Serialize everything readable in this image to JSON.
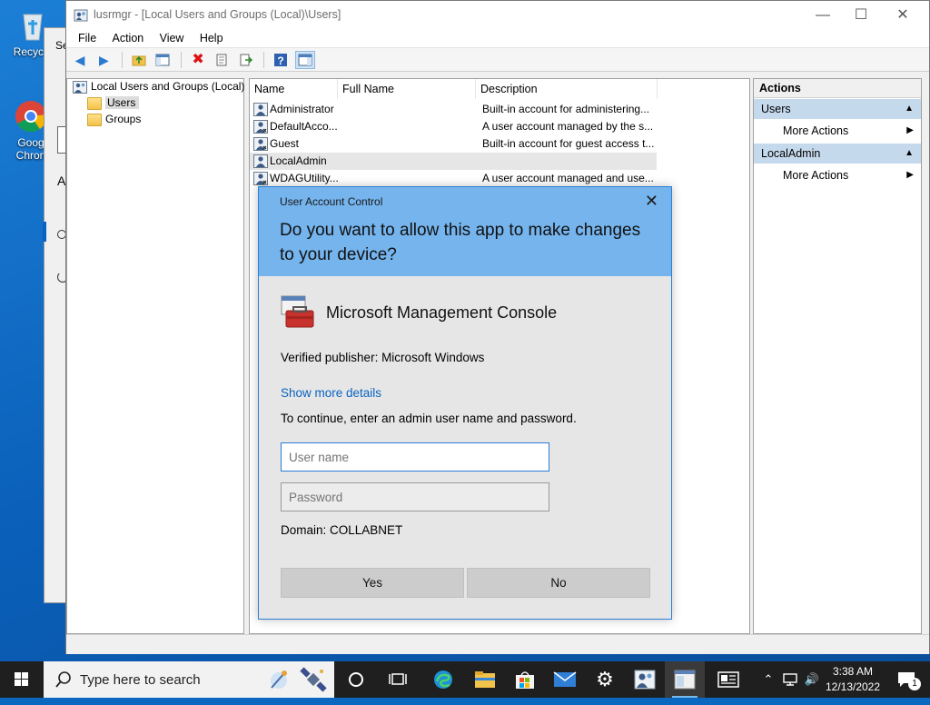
{
  "desktop": {
    "icons": [
      {
        "label": "Recycle"
      },
      {
        "label": "Goog Chron"
      }
    ],
    "bg_window": {
      "fragments": [
        "Se",
        "A"
      ]
    }
  },
  "window": {
    "title": "lusrmgr - [Local Users and Groups (Local)\\Users]",
    "controls": {
      "minimize": "—",
      "maximize": "☐",
      "close": "✕"
    },
    "menu": [
      "File",
      "Action",
      "View",
      "Help"
    ]
  },
  "tree": {
    "root": "Local Users and Groups (Local)",
    "children": [
      "Users",
      "Groups"
    ],
    "selected": "Users"
  },
  "list": {
    "columns": [
      "Name",
      "Full Name",
      "Description"
    ],
    "rows": [
      {
        "name": "Administrator",
        "full_name": "",
        "description": "Built-in account for administering..."
      },
      {
        "name": "DefaultAcco...",
        "full_name": "",
        "description": "A user account managed by the s..."
      },
      {
        "name": "Guest",
        "full_name": "",
        "description": "Built-in account for guest access t..."
      },
      {
        "name": "LocalAdmin",
        "full_name": "",
        "description": ""
      },
      {
        "name": "WDAGUtility...",
        "full_name": "",
        "description": "A user account managed and use..."
      }
    ],
    "highlighted": "LocalAdmin"
  },
  "actions": {
    "title": "Actions",
    "sections": [
      {
        "label": "Users",
        "items": [
          "More Actions"
        ]
      },
      {
        "label": "LocalAdmin",
        "items": [
          "More Actions"
        ]
      }
    ]
  },
  "uac": {
    "caption": "User Account Control",
    "question": "Do you want to allow this app to make changes to your device?",
    "app_name": "Microsoft Management Console",
    "publisher": "Verified publisher: Microsoft Windows",
    "show_more": "Show more details",
    "instruction": "To continue, enter an admin user name and password.",
    "username_placeholder": "User name",
    "password_placeholder": "Password",
    "domain": "Domain: COLLABNET",
    "yes": "Yes",
    "no": "No",
    "accent_color": "#75b4ed"
  },
  "taskbar": {
    "search_placeholder": "Type here to search",
    "time": "3:38 AM",
    "date": "12/13/2022",
    "notification_count": "1"
  }
}
